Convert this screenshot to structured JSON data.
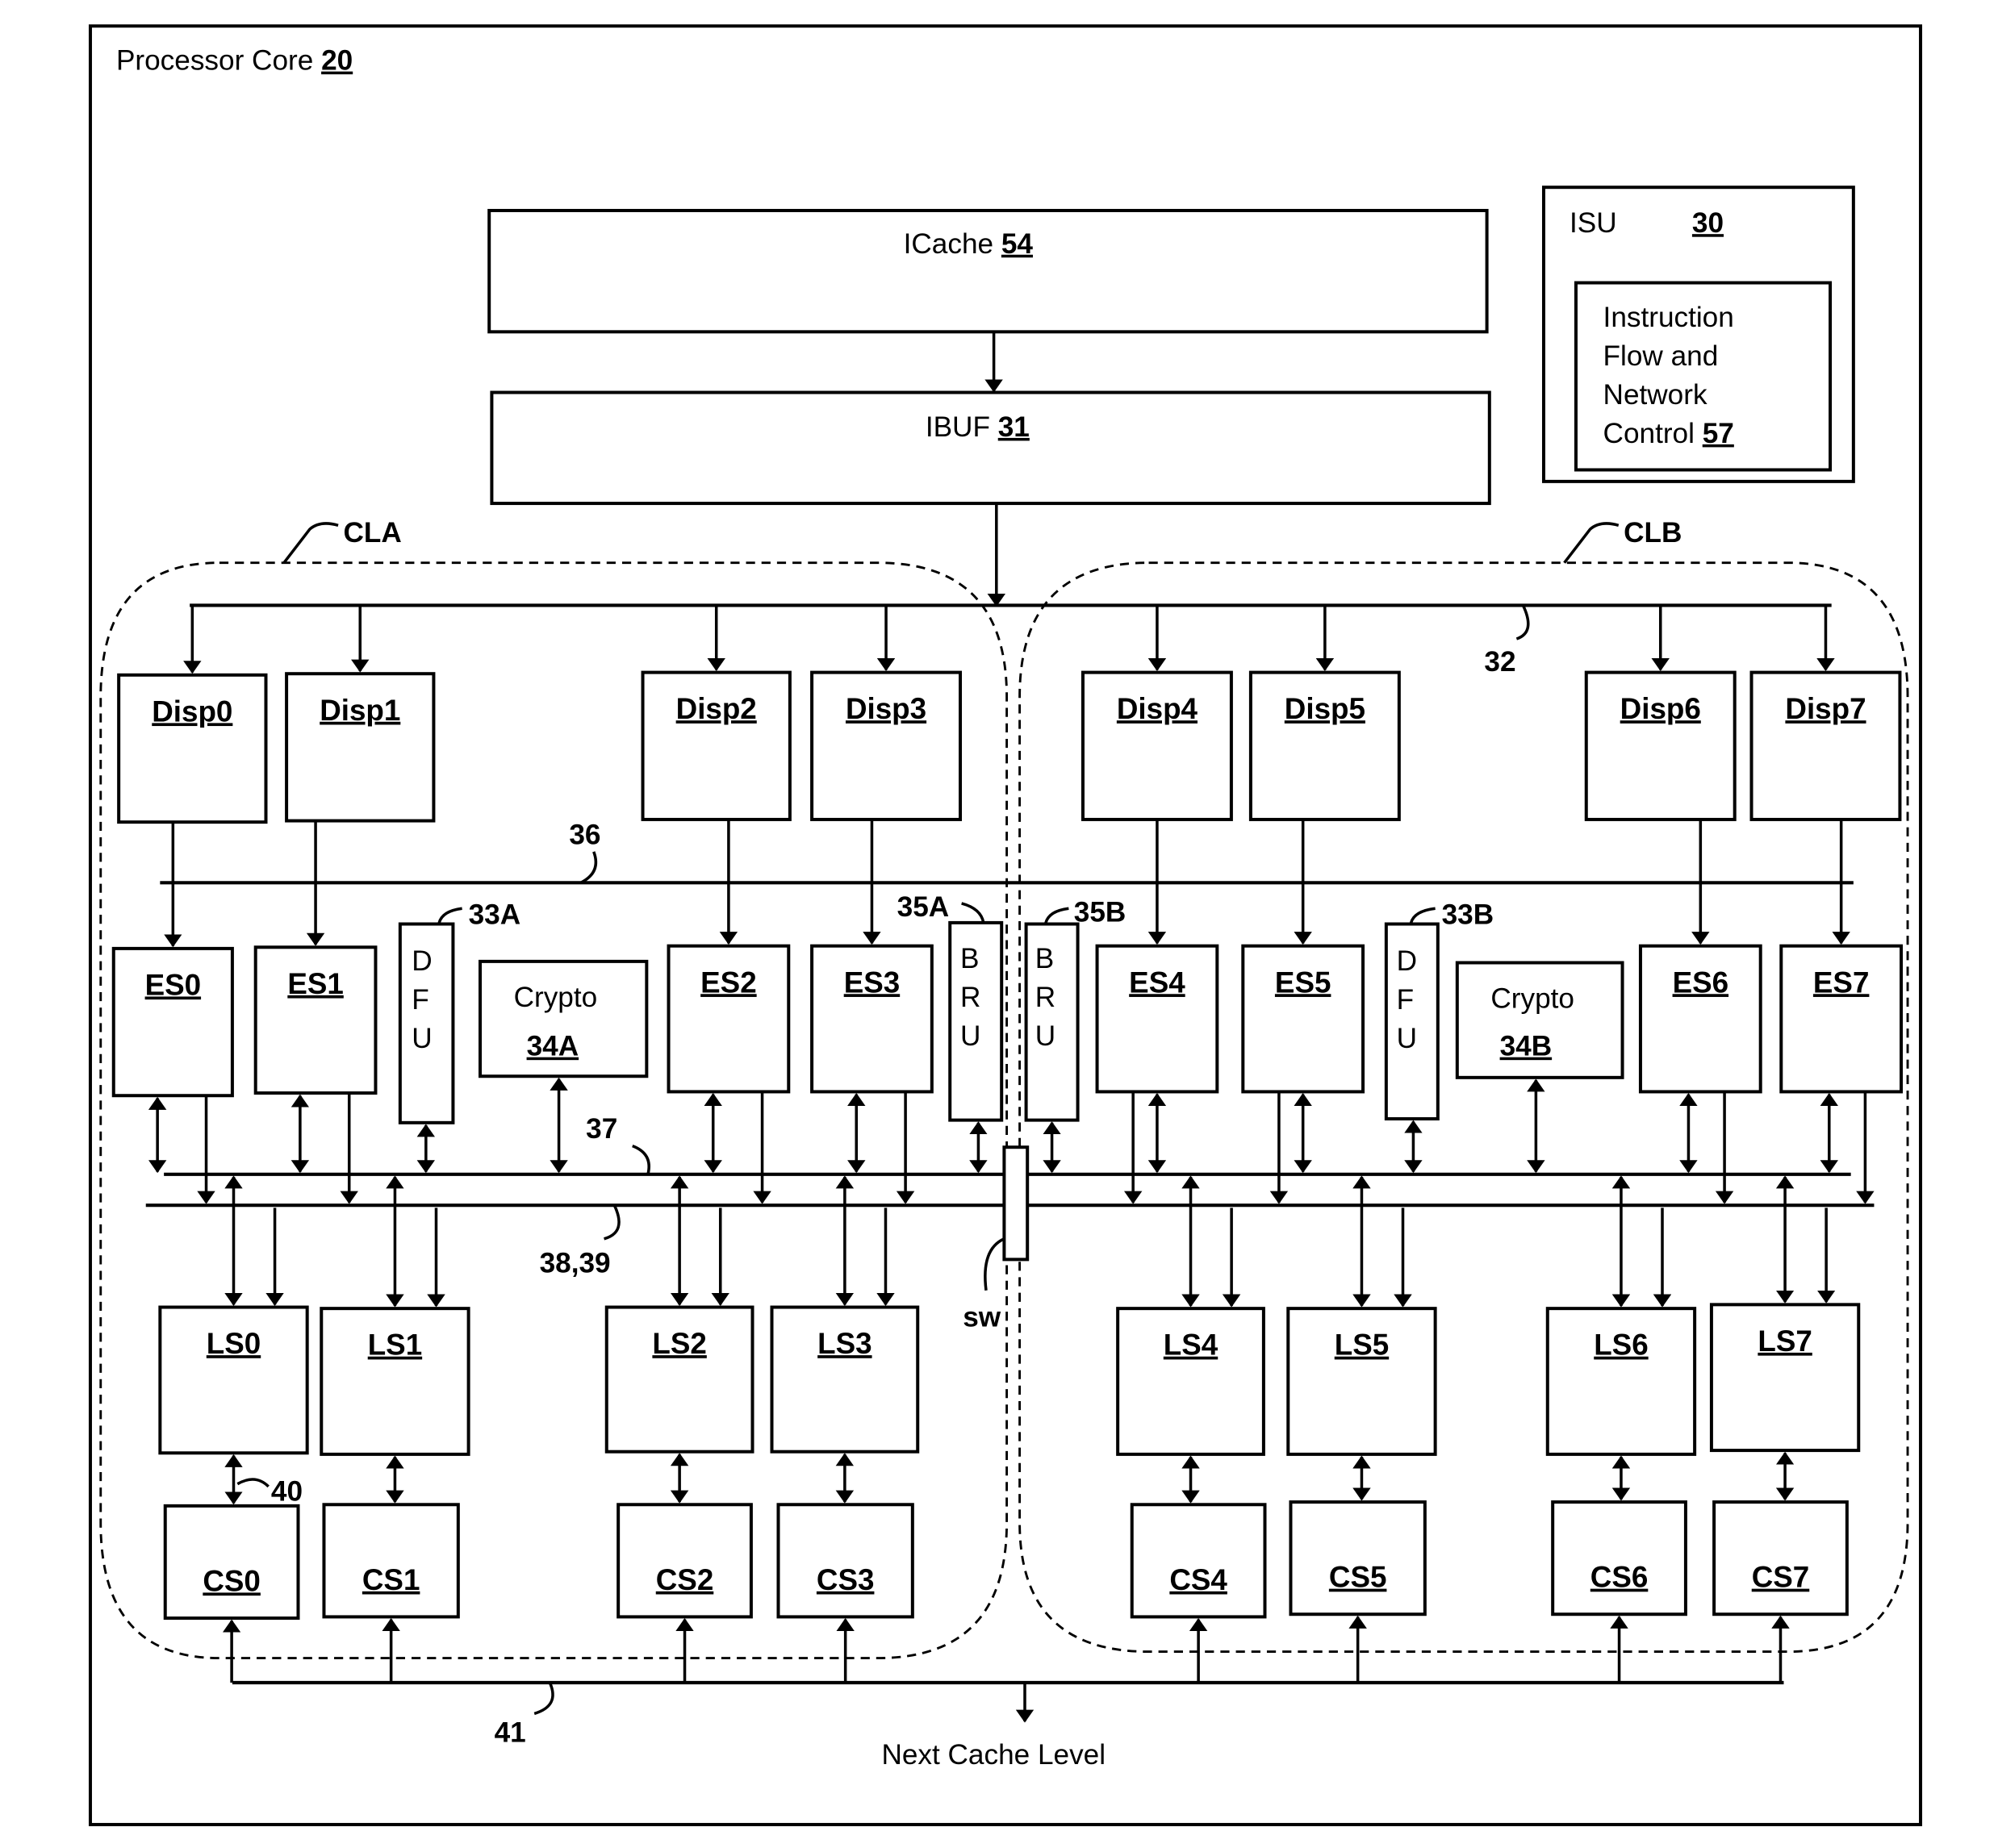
{
  "core": {
    "label": "Processor Core",
    "ref": "20"
  },
  "icache": {
    "label": "ICache",
    "ref": "54"
  },
  "ibuf": {
    "label": "IBUF",
    "ref": "31"
  },
  "isu": {
    "label": "ISU",
    "ref": "30",
    "inner_lines": [
      "Instruction",
      "Flow and",
      "Network",
      "Control"
    ],
    "inner_ref": "57"
  },
  "clusters": {
    "a": "CLA",
    "b": "CLB"
  },
  "dispatch": [
    "Disp0",
    "Disp1",
    "Disp2",
    "Disp3",
    "Disp4",
    "Disp5",
    "Disp6",
    "Disp7"
  ],
  "exec": [
    "ES0",
    "ES1",
    "ES2",
    "ES3",
    "ES4",
    "ES5",
    "ES6",
    "ES7"
  ],
  "loadstore": [
    "LS0",
    "LS1",
    "LS2",
    "LS3",
    "LS4",
    "LS5",
    "LS6",
    "LS7"
  ],
  "cache": [
    "CS0",
    "CS1",
    "CS2",
    "CS3",
    "CS4",
    "CS5",
    "CS6",
    "CS7"
  ],
  "dfu": {
    "letters": [
      "D",
      "F",
      "U"
    ],
    "ref_a": "33A",
    "ref_b": "33B"
  },
  "bru": {
    "letters": [
      "B",
      "R",
      "U"
    ],
    "ref_a": "35A",
    "ref_b": "35B"
  },
  "crypto": {
    "label": "Crypto",
    "ref_a": "34A",
    "ref_b": "34B"
  },
  "refs": {
    "dispatch_bus": "32",
    "bus36": "36",
    "bus37": "37",
    "bus38": "38,39",
    "link40": "40",
    "bus41": "41",
    "switch": "sw"
  },
  "next_cache": "Next Cache Level"
}
